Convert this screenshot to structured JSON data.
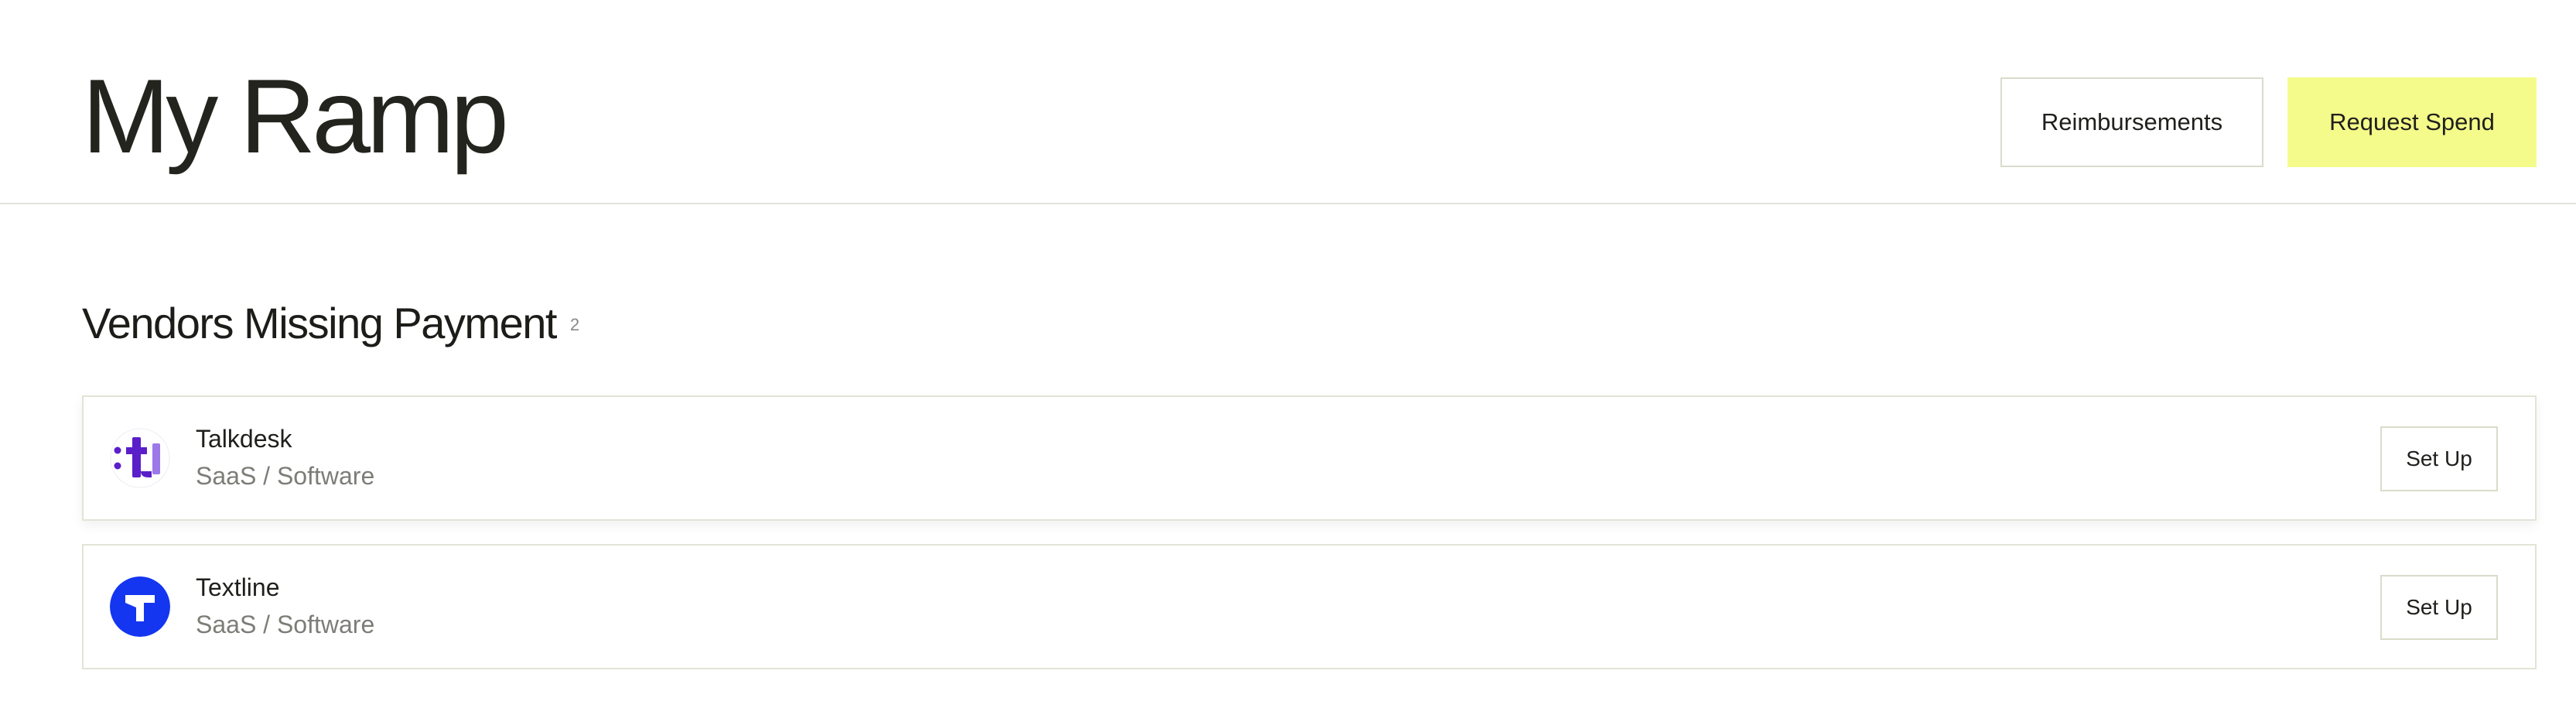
{
  "header": {
    "title": "My Ramp",
    "reimbursements_label": "Reimbursements",
    "request_spend_label": "Request Spend"
  },
  "section": {
    "title": "Vendors Missing Payment",
    "count": "2"
  },
  "vendors": [
    {
      "name": "Talkdesk",
      "category": "SaaS / Software",
      "action_label": "Set Up",
      "logo_icon": "talkdesk-logo-icon",
      "logo_color": "#5a1fc9"
    },
    {
      "name": "Textline",
      "category": "SaaS / Software",
      "action_label": "Set Up",
      "logo_icon": "textline-logo-icon",
      "logo_color": "#1436f0"
    }
  ],
  "colors": {
    "accent": "#f4fb8a",
    "border": "#e2e4d6",
    "muted_text": "#7d7d77"
  }
}
